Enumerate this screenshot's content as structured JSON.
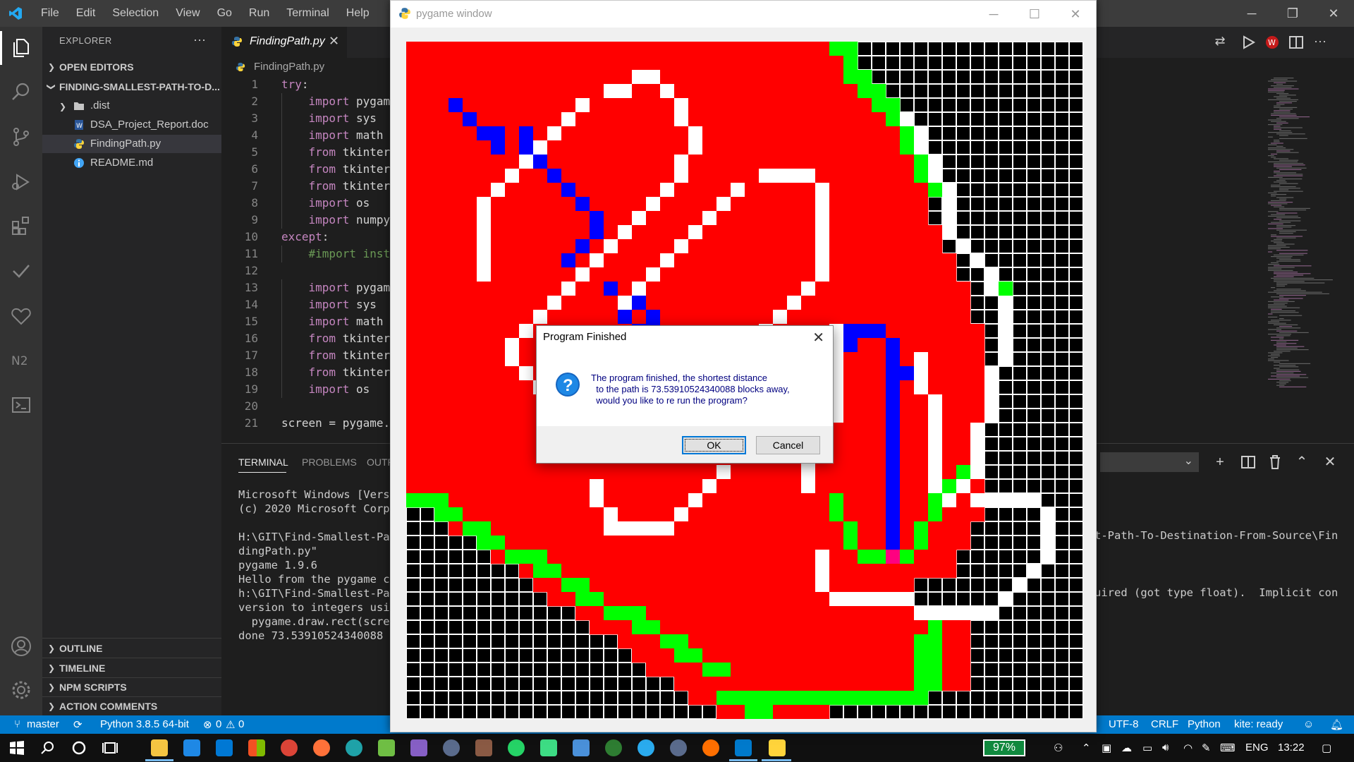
{
  "vscode": {
    "menu": [
      "File",
      "Edit",
      "Selection",
      "View",
      "Go",
      "Run",
      "Terminal",
      "Help"
    ],
    "window_controls": {
      "minimize": "─",
      "restore": "❐",
      "close": "✕"
    },
    "sidebar": {
      "header": "EXPLORER",
      "more": "···",
      "open_editors": "OPEN EDITORS",
      "folder": "FINDING-SMALLEST-PATH-TO-D...",
      "items": [
        {
          "label": ".dist",
          "icon": "folder-icon"
        },
        {
          "label": "DSA_Project_Report.doc",
          "icon": "word-doc-icon"
        },
        {
          "label": "FindingPath.py",
          "icon": "python-icon"
        },
        {
          "label": "README.md",
          "icon": "info-icon"
        }
      ],
      "outline": "OUTLINE",
      "timeline": "TIMELINE",
      "npm_scripts": "NPM SCRIPTS",
      "action_comments": "ACTION COMMENTS"
    },
    "tab": {
      "label": "FindingPath.py",
      "close": "✕"
    },
    "breadcrumb": "FindingPath.py",
    "code": {
      "line_numbers": [
        "1",
        "2",
        "3",
        "4",
        "5",
        "6",
        "7",
        "8",
        "9",
        "10",
        "11",
        "12",
        "13",
        "14",
        "15",
        "16",
        "17",
        "18",
        "19",
        "20",
        "21"
      ],
      "lines": [
        {
          "kw": "try",
          "rest": ":"
        },
        {
          "indent": "    ",
          "kw": "import",
          "rest": " pygam"
        },
        {
          "indent": "    ",
          "kw": "import",
          "rest": " sys"
        },
        {
          "indent": "    ",
          "kw": "import",
          "rest": " math"
        },
        {
          "indent": "    ",
          "kw": "from",
          "rest": " tkinter"
        },
        {
          "indent": "    ",
          "kw": "from",
          "rest": " tkinter"
        },
        {
          "indent": "    ",
          "kw": "from",
          "rest": " tkinter"
        },
        {
          "indent": "    ",
          "kw": "import",
          "rest": " os"
        },
        {
          "indent": "    ",
          "kw": "import",
          "rest": " numpy"
        },
        {
          "kw": "except",
          "rest": ":"
        },
        {
          "indent": "    ",
          "comment": "#import inst"
        },
        {
          "rest": ""
        },
        {
          "indent": "    ",
          "kw": "import",
          "rest": " pygam"
        },
        {
          "indent": "    ",
          "kw": "import",
          "rest": " sys"
        },
        {
          "indent": "    ",
          "kw": "import",
          "rest": " math"
        },
        {
          "indent": "    ",
          "kw": "from",
          "rest": " tkinter"
        },
        {
          "indent": "    ",
          "kw": "from",
          "rest": " tkinter"
        },
        {
          "indent": "    ",
          "kw": "from",
          "rest": " tkinter"
        },
        {
          "indent": "    ",
          "kw": "import",
          "rest": " os"
        },
        {
          "rest": ""
        },
        {
          "rest": "screen = pygame."
        }
      ]
    },
    "panel": {
      "tabs": [
        "TERMINAL",
        "PROBLEMS",
        "OUTP"
      ],
      "terminal_lines": [
        "Microsoft Windows [Versi",
        "(c) 2020 Microsoft Corpo",
        "",
        "H:\\GIT\\Find-Smallest-Pat",
        "dingPath.py\"",
        "pygame 1.9.6",
        "Hello from the pygame co",
        "h:\\GIT\\Find-Smallest-Pat",
        "version to integers usin",
        "  pygame.draw.rect(scree",
        "done 73.53910524340088"
      ],
      "terminal_right_1": "t-Path-To-Destination-From-Source\\Fin",
      "terminal_right_2": "uired (got type float).  Implicit con",
      "actions": {
        "add": "+",
        "split": "⊟",
        "trash": "🗑",
        "maximize": "⌃",
        "close": "✕",
        "select": "⌄"
      }
    },
    "status": {
      "branch": "master",
      "python": "Python 3.8.5 64-bit",
      "errors": "0",
      "warnings": "0",
      "encoding": "UTF-8",
      "eol": "CRLF",
      "language": "Python",
      "kite": "kite: ready"
    }
  },
  "pygame": {
    "title": "pygame window",
    "controls": {
      "minimize": "─",
      "maximize": "☐",
      "close": "✕"
    },
    "grid_size": 48,
    "colors": {
      "bg": "#ff0000",
      "wall": "#000000",
      "open": "#ffffff",
      "border": "#00ff00",
      "path": "#0000ff",
      "goal": "#ff0080"
    }
  },
  "dialog": {
    "title": "Program Finished",
    "close": "✕",
    "message": "The program finished, the shortest distance\n  to the path is 73.53910524340088 blocks away,\n  would you like to re run the program?",
    "ok": "OK",
    "cancel": "Cancel"
  },
  "taskbar": {
    "battery": "97%",
    "language": "ENG",
    "time": "13:22"
  }
}
